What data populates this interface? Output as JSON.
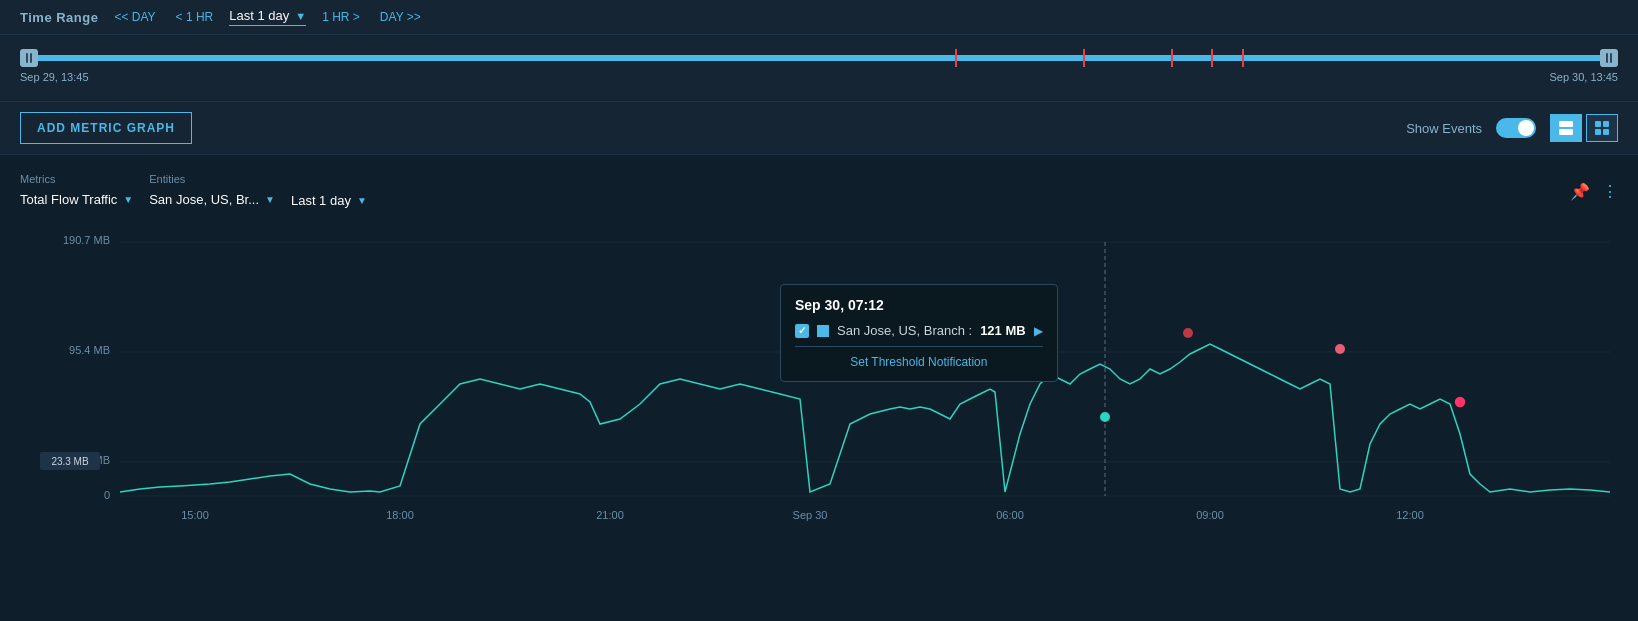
{
  "topbar": {
    "label": "Time Range",
    "nav_prev_day": "<< DAY",
    "nav_prev_hr": "< 1 HR",
    "current_range": "Last 1 day",
    "nav_next_hr": "1 HR >",
    "nav_next_day": "DAY >>"
  },
  "slider": {
    "start_time": "Sep 29, 13:45",
    "end_time": "Sep 30, 13:45",
    "event_markers": [
      58.5,
      66.5,
      72.0,
      74.5,
      76.5
    ]
  },
  "toolbar": {
    "add_metric_label": "ADD METRIC GRAPH",
    "show_events_label": "Show Events",
    "view_single_label": "single",
    "view_grid_label": "grid"
  },
  "chart": {
    "metrics_label": "Metrics",
    "metrics_value": "Total Flow Traffic",
    "entities_label": "Entities",
    "entities_value": "San Jose, US, Br...",
    "timerange_value": "Last 1 day",
    "y_labels": [
      "190.7 MB",
      "95.4 MB",
      "23.3 MB",
      "0"
    ],
    "x_labels": [
      "15:00",
      "18:00",
      "21:00",
      "Sep 30",
      "06:00",
      "09:00",
      "12:00"
    ],
    "tooltip": {
      "timestamp": "Sep 30, 07:12",
      "entity": "San Jose, US, Branch :",
      "value": "121 MB",
      "threshold_label": "Set Threshold Notification"
    }
  },
  "icons": {
    "pin": "📌",
    "more": "⋮",
    "checkmark": "✓"
  }
}
